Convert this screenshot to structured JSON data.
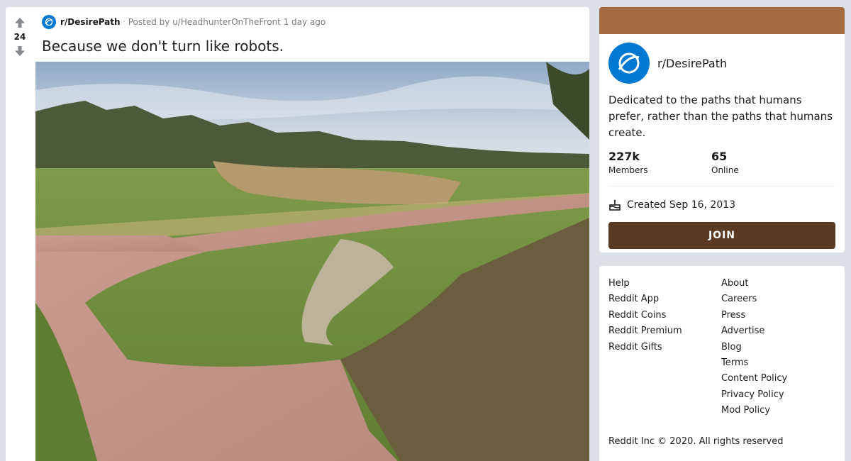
{
  "post": {
    "score": "24",
    "subreddit": "r/DesirePath",
    "separator": "·",
    "posted_by": "Posted by u/HeadhunterOnTheFront 1 day ago",
    "title": "Because we don't turn like robots."
  },
  "sidebar": {
    "subreddit": "r/DesirePath",
    "description": "Dedicated to the paths that humans prefer, rather than the paths that humans create.",
    "members_count": "227k",
    "members_label": "Members",
    "online_count": "65",
    "online_label": "Online",
    "created": "Created Sep 16, 2013",
    "join_label": "JOIN"
  },
  "footer": {
    "left_links": [
      "Help",
      "Reddit App",
      "Reddit Coins",
      "Reddit Premium",
      "Reddit Gifts"
    ],
    "right_links": [
      "About",
      "Careers",
      "Press",
      "Advertise",
      "Blog",
      "Terms",
      "Content Policy",
      "Privacy Policy",
      "Mod Policy"
    ],
    "copyright": "Reddit Inc © 2020. All rights reserved"
  },
  "colors": {
    "banner": "#a56a3f",
    "join_button": "#5a3a22",
    "subreddit_icon": "#0079d3",
    "page_background": "#dae0e6"
  },
  "icons": [
    "upvote-icon",
    "downvote-icon",
    "subreddit-planet-icon",
    "cake-icon"
  ]
}
